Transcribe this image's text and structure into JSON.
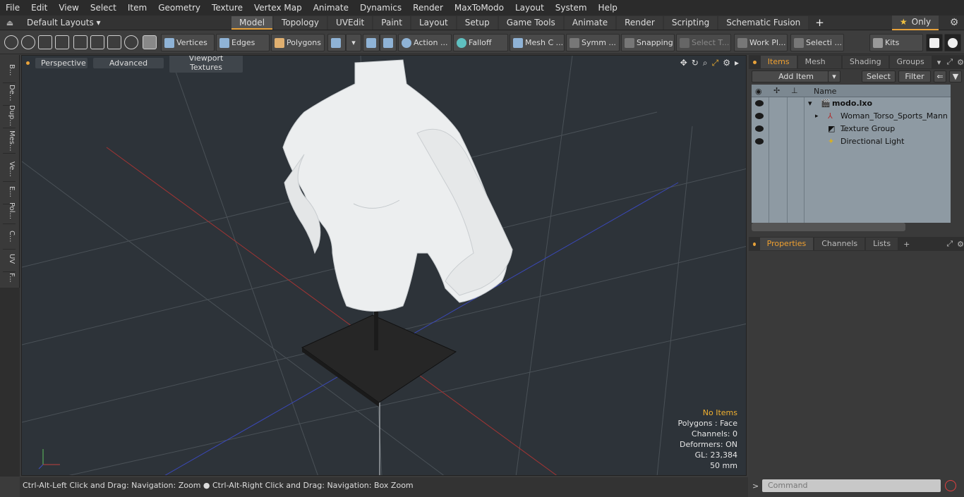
{
  "menu": [
    "File",
    "Edit",
    "View",
    "Select",
    "Item",
    "Geometry",
    "Texture",
    "Vertex Map",
    "Animate",
    "Dynamics",
    "Render",
    "MaxToModo",
    "Layout",
    "System",
    "Help"
  ],
  "layouts_label": "Default Layouts ▾",
  "layout_tabs": [
    "Model",
    "Topology",
    "UVEdit",
    "Paint",
    "Layout",
    "Setup",
    "Game Tools",
    "Animate",
    "Render",
    "Scripting",
    "Schematic Fusion"
  ],
  "active_tab": "Model",
  "only_label": "Only",
  "toolbar": {
    "vertices": "Vertices",
    "edges": "Edges",
    "polygons": "Polygons",
    "action": "Action ...",
    "falloff": "Falloff",
    "mesh": "Mesh C ...",
    "symm": "Symm ...",
    "snapping": "Snapping",
    "select_t": "Select T...",
    "workpl": "Work Pl...",
    "selecti": "Selecti ...",
    "kits": "Kits"
  },
  "left_tabs": [
    "B...",
    "De...",
    "Dup...",
    "Mes...",
    "Ve...",
    "E...",
    "Pol...",
    "C...",
    "UV",
    "F..."
  ],
  "viewport": {
    "view_label": "Perspective",
    "advanced_label": "Advanced",
    "textures_label": "Viewport Textures",
    "info": [
      "No Items",
      "Polygons : Face",
      "Channels: 0",
      "Deformers: ON",
      "GL: 23,384",
      "50 mm"
    ]
  },
  "status_text": "Ctrl-Alt-Left Click and Drag: Navigation: Zoom ● Ctrl-Alt-Right Click and Drag: Navigation: Box Zoom",
  "items_panel": {
    "tabs": [
      "Items",
      "Mesh ...",
      "Shading",
      "Groups"
    ],
    "add_item": "Add Item",
    "select": "Select",
    "filter": "Filter",
    "name_header": "Name",
    "rows": [
      "modo.lxo",
      "Woman_Torso_Sports_Mann ...",
      "Texture Group",
      "Directional Light"
    ]
  },
  "props_panel": {
    "tabs": [
      "Properties",
      "Channels",
      "Lists"
    ]
  },
  "command_placeholder": "Command",
  "colors": {
    "accent": "#e8a23a",
    "viewport_bg": "#2d3339",
    "grid_red": "#b03030",
    "grid_blue": "#3040b0"
  }
}
